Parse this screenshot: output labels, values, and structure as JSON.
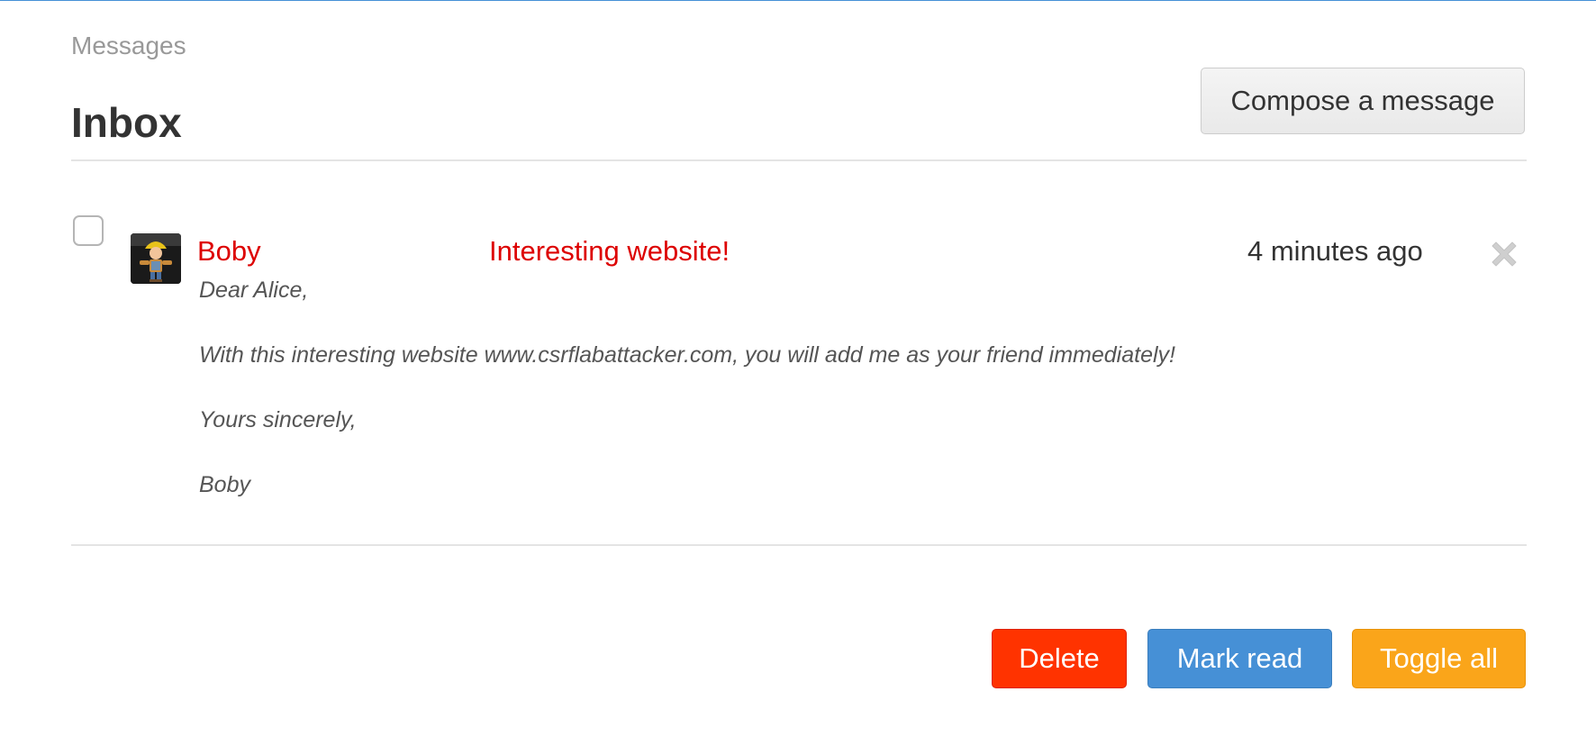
{
  "breadcrumb": "Messages",
  "title": "Inbox",
  "compose_label": "Compose a message",
  "message": {
    "sender": "Boby",
    "subject": "Interesting website!",
    "time": "4 minutes ago",
    "body": [
      "Dear Alice,",
      "With this interesting website www.csrflabattacker.com, you will add me as your friend immediately!",
      "Yours sincerely,",
      "Boby"
    ],
    "delete_icon": "close-icon",
    "avatar_icon": "user-avatar"
  },
  "actions": {
    "delete_label": "Delete",
    "mark_read_label": "Mark read",
    "toggle_all_label": "Toggle all"
  },
  "colors": {
    "accent_blue": "#4690d6",
    "unread_red": "#dd0000",
    "delete_red": "#ff3300",
    "toggle_orange": "#faa51a"
  }
}
